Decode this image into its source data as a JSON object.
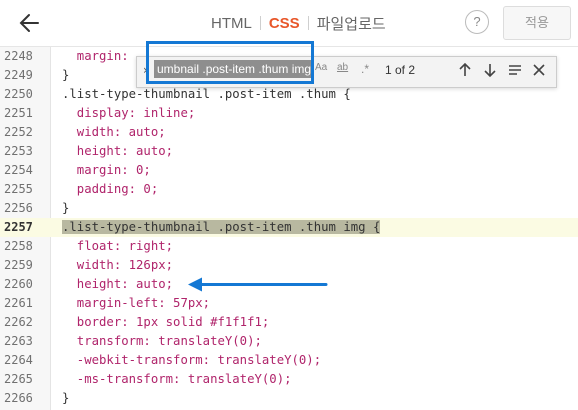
{
  "header": {
    "tabs": [
      {
        "label": "HTML",
        "active": false
      },
      {
        "label": "CSS",
        "active": true
      },
      {
        "label": "파일업로드",
        "active": false
      }
    ],
    "help_label": "?",
    "apply_label": "적용"
  },
  "search": {
    "query": "umbnail .post-item .thum img",
    "option_case": "Aa",
    "option_word": "ab",
    "option_regex": ".*",
    "count": "1 of 2"
  },
  "lines": [
    {
      "num": "2248",
      "text": "  margin: "
    },
    {
      "num": "2249",
      "text": "}"
    },
    {
      "num": "2250",
      "text": ".list-type-thumbnail .post-item .thum {"
    },
    {
      "num": "2251",
      "text": "  display: inline;"
    },
    {
      "num": "2252",
      "text": "  width: auto;"
    },
    {
      "num": "2253",
      "text": "  height: auto;"
    },
    {
      "num": "2254",
      "text": "  margin: 0;"
    },
    {
      "num": "2255",
      "text": "  padding: 0;"
    },
    {
      "num": "2256",
      "text": "}"
    },
    {
      "num": "2257",
      "text": ".list-type-thumbnail .post-item .thum img {"
    },
    {
      "num": "2258",
      "text": "  float: right;"
    },
    {
      "num": "2259",
      "text": "  width: 126px;"
    },
    {
      "num": "2260",
      "text": "  height: auto;"
    },
    {
      "num": "2261",
      "text": "  margin-left: 57px;"
    },
    {
      "num": "2262",
      "text": "  border: 1px solid #f1f1f1;"
    },
    {
      "num": "2263",
      "text": "  transform: translateY(0);"
    },
    {
      "num": "2264",
      "text": "  -webkit-transform: translateY(0);"
    },
    {
      "num": "2265",
      "text": "  -ms-transform: translateY(0);"
    },
    {
      "num": "2266",
      "text": "}"
    }
  ],
  "colors": {
    "accent": "#e8572a",
    "annotation": "#1478d4",
    "property": "#b0246b",
    "value": "#0a7d5a"
  }
}
